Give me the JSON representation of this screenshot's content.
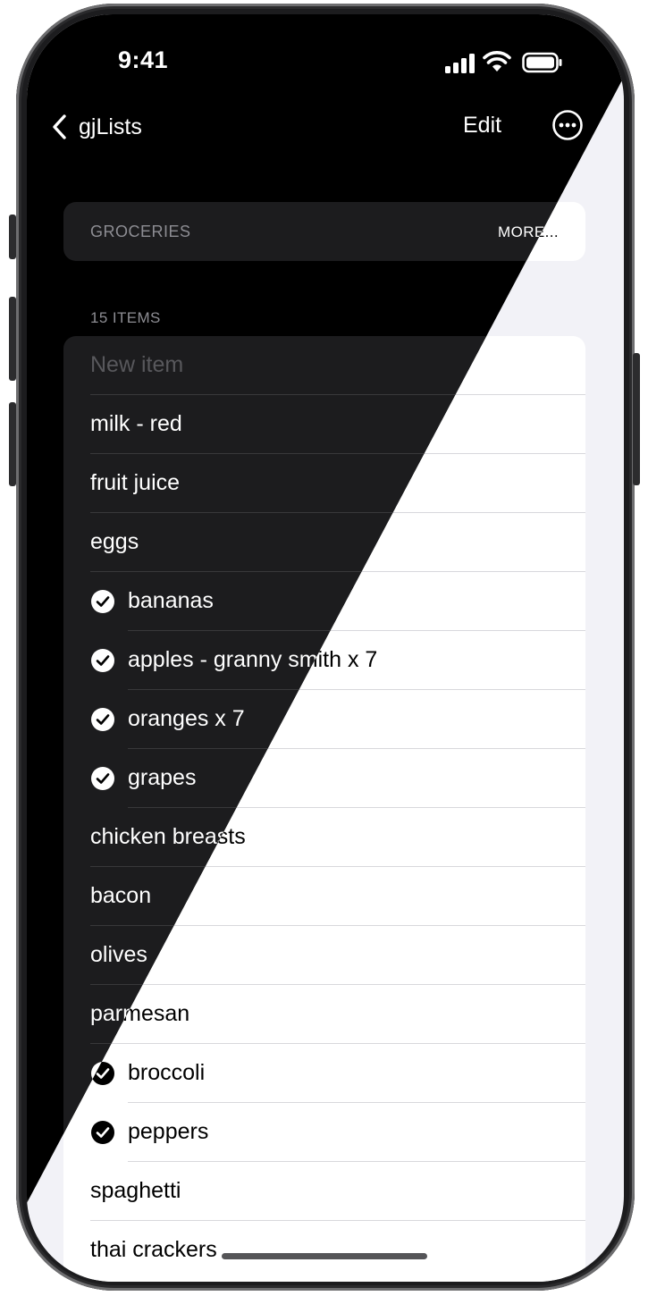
{
  "status_bar": {
    "time": "9:41"
  },
  "nav": {
    "back_label": "gjLists",
    "edit_label": "Edit"
  },
  "header": {
    "list_name": "GROCERIES",
    "more_label": "MORE..."
  },
  "list": {
    "count_label": "15 ITEMS",
    "new_item_placeholder": "New item",
    "items": [
      {
        "label": "milk - red",
        "checked": false
      },
      {
        "label": "fruit juice",
        "checked": false
      },
      {
        "label": "eggs",
        "checked": false
      },
      {
        "label": "bananas",
        "checked": true
      },
      {
        "label": "apples - granny smith x 7",
        "checked": true
      },
      {
        "label": "oranges x 7",
        "checked": true
      },
      {
        "label": "grapes",
        "checked": true
      },
      {
        "label": "chicken breasts",
        "checked": false
      },
      {
        "label": "bacon",
        "checked": false
      },
      {
        "label": "olives",
        "checked": false
      },
      {
        "label": "parmesan",
        "checked": false
      },
      {
        "label": "broccoli",
        "checked": true
      },
      {
        "label": "peppers",
        "checked": true
      },
      {
        "label": "spaghetti",
        "checked": false
      },
      {
        "label": "thai crackers",
        "checked": false
      }
    ]
  },
  "theme": {
    "light": {
      "background": "#f2f2f7",
      "card": "#ffffff",
      "text": "#000000",
      "secondary": "#6c6c70"
    },
    "dark": {
      "background": "#000000",
      "card": "#1c1c1e",
      "text": "#ffffff",
      "secondary": "#8d8d93"
    }
  },
  "icons": [
    "back-chevron-icon",
    "ellipsis-circle-icon",
    "checkmark-circle-icon",
    "cellular-signal-icon",
    "wifi-icon",
    "battery-icon"
  ]
}
